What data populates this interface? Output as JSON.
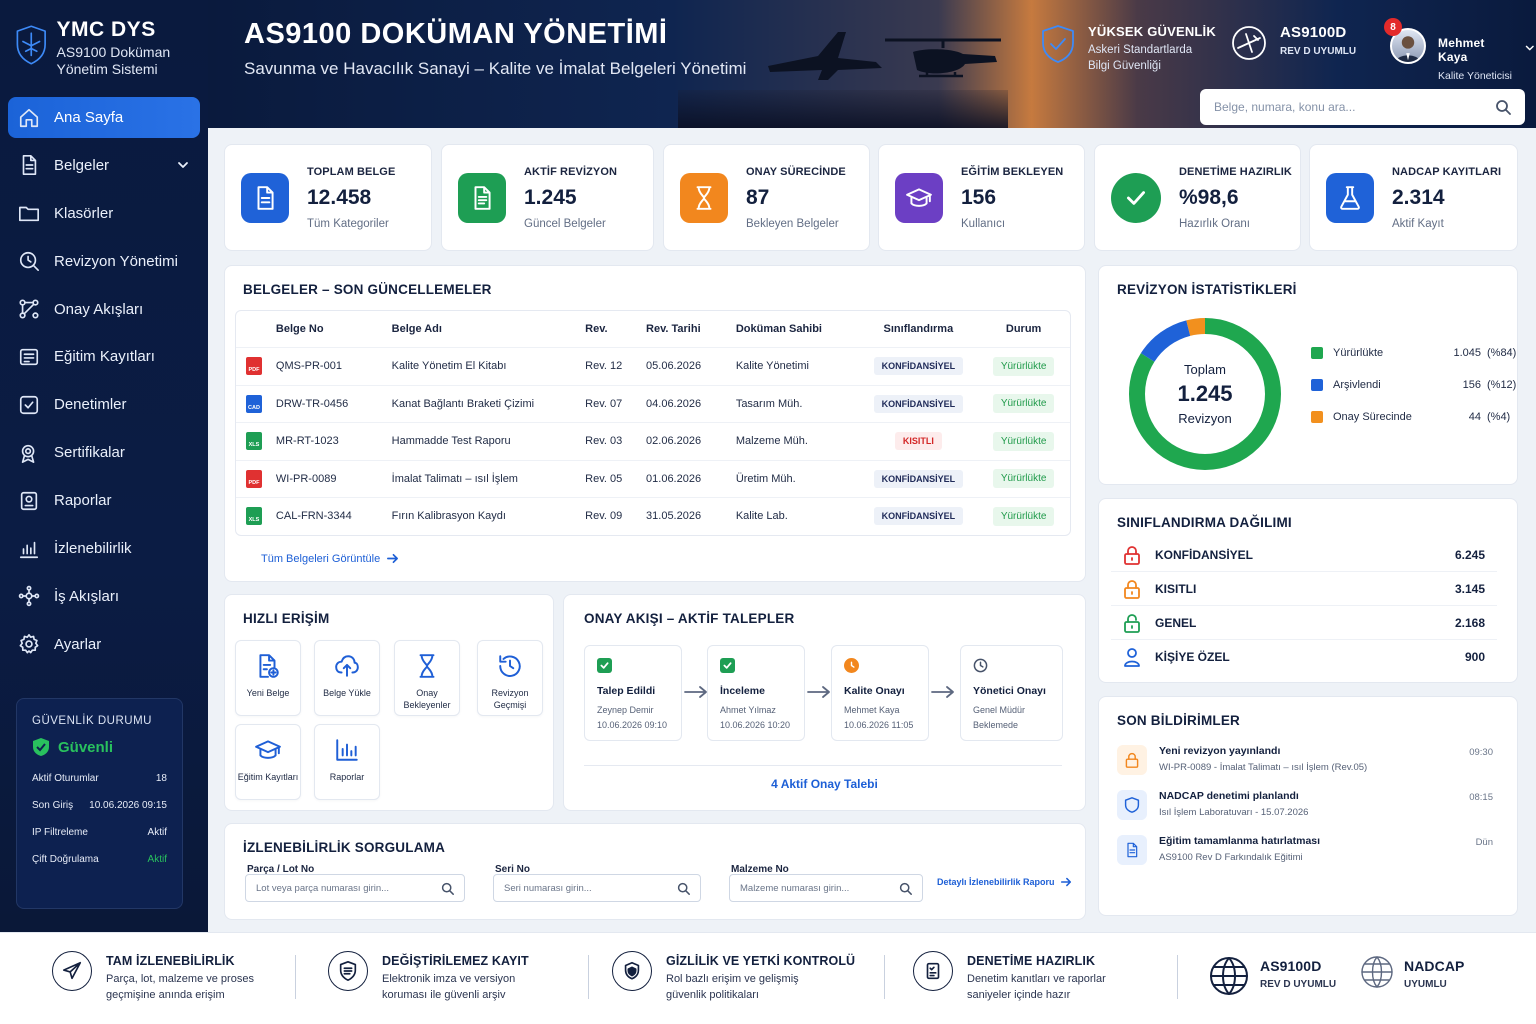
{
  "brand": {
    "name": "YMC DYS",
    "subtitle": "AS9100 Doküman Yönetim Sistemi"
  },
  "sidebar": {
    "items": [
      {
        "label": "Ana Sayfa",
        "icon": "home-icon",
        "active": true
      },
      {
        "label": "Belgeler",
        "icon": "document-icon",
        "has_submenu": true
      },
      {
        "label": "Klasörler",
        "icon": "folder-icon"
      },
      {
        "label": "Revizyon Yönetimi",
        "icon": "revision-icon"
      },
      {
        "label": "Onay Akışları",
        "icon": "workflow-icon"
      },
      {
        "label": "Eğitim Kayıtları",
        "icon": "training-icon"
      },
      {
        "label": "Denetimler",
        "icon": "audit-check-icon"
      },
      {
        "label": "Sertifikalar",
        "icon": "certificate-icon"
      },
      {
        "label": "Raporlar",
        "icon": "report-icon"
      },
      {
        "label": "İzlenebilirlik",
        "icon": "traceability-icon"
      },
      {
        "label": "İş Akışları",
        "icon": "process-icon"
      },
      {
        "label": "Ayarlar",
        "icon": "gear-icon"
      }
    ],
    "security": {
      "title": "GÜVENLİK DURUMU",
      "status": "Güvenli",
      "rows": [
        {
          "label": "Aktif Oturumlar",
          "value": "18"
        },
        {
          "label": "Son Giriş",
          "value": "10.06.2026 09:15"
        },
        {
          "label": "IP Filtreleme",
          "value": "Aktif"
        },
        {
          "label": "Çift Doğrulama",
          "value": "Aktif"
        }
      ]
    }
  },
  "header": {
    "title": "AS9100 DOKÜMAN YÖNETİMİ",
    "subtitle": "Savunma ve Havacılık Sanayi – Kalite ve İmalat Belgeleri Yönetimi",
    "badge1": {
      "title": "YÜKSEK GÜVENLİK",
      "line1": "Askeri Standartlarda",
      "line2": "Bilgi Güvenliği"
    },
    "badge2": {
      "title": "AS9100D",
      "line1": "REV D UYUMLU"
    },
    "user": {
      "name": "Mehmet Kaya",
      "role": "Kalite Yöneticisi",
      "notifications": "8"
    },
    "search": {
      "placeholder": "Belge, numara, konu ara..."
    }
  },
  "kpis": [
    {
      "label": "TOPLAM BELGE",
      "value": "12.458",
      "sub": "Tüm Kategoriler",
      "color": "#1f62d8",
      "icon": "document-icon"
    },
    {
      "label": "AKTİF REVİZYON",
      "value": "1.245",
      "sub": "Güncel Belgeler",
      "color": "#1e9e54",
      "icon": "file-text-icon"
    },
    {
      "label": "ONAY SÜRECİNDE",
      "value": "87",
      "sub": "Bekleyen Belgeler",
      "color": "#f2871e",
      "icon": "hourglass-icon"
    },
    {
      "label": "EĞİTİM BEKLEYEN",
      "value": "156",
      "sub": "Kullanıcı",
      "color": "#6c3fc4",
      "icon": "graduation-cap-icon"
    },
    {
      "label": "DENETİME HAZIRLIK",
      "value": "%98,6",
      "sub": "Hazırlık Oranı",
      "color": "#1e9e54",
      "icon": "check-icon"
    },
    {
      "label": "NADCAP KAYITLARI",
      "value": "2.314",
      "sub": "Aktif Kayıt",
      "color": "#1f62d8",
      "icon": "flask-icon"
    }
  ],
  "documents": {
    "title": "BELGELER – SON GÜNCELLEMELER",
    "columns": [
      "Belge No",
      "Belge Adı",
      "Rev.",
      "Rev. Tarihi",
      "Doküman Sahibi",
      "Sınıflandırma",
      "Durum"
    ],
    "rows": [
      {
        "type": "PDF",
        "no": "QMS-PR-001",
        "name": "Kalite Yönetim El Kitabı",
        "rev": "Rev. 12",
        "date": "05.06.2026",
        "owner": "Kalite Yönetimi",
        "class": "KONFİDANSİYEL",
        "status": "Yürürlükte"
      },
      {
        "type": "CAD",
        "no": "DRW-TR-0456",
        "name": "Kanat Bağlantı Braketi Çizimi",
        "rev": "Rev. 07",
        "date": "04.06.2026",
        "owner": "Tasarım Müh.",
        "class": "KONFİDANSİYEL",
        "status": "Yürürlükte"
      },
      {
        "type": "XLS",
        "no": "MR-RT-1023",
        "name": "Hammadde Test Raporu",
        "rev": "Rev. 03",
        "date": "02.06.2026",
        "owner": "Malzeme Müh.",
        "class": "KISITLI",
        "status": "Yürürlükte"
      },
      {
        "type": "PDF",
        "no": "WI-PR-0089",
        "name": "İmalat Talimatı – ısıl İşlem",
        "rev": "Rev. 05",
        "date": "01.06.2026",
        "owner": "Üretim Müh.",
        "class": "KONFİDANSİYEL",
        "status": "Yürürlükte"
      },
      {
        "type": "XLS",
        "no": "CAL-FRN-3344",
        "name": "Fırın Kalibrasyon Kaydı",
        "rev": "Rev. 09",
        "date": "31.05.2026",
        "owner": "Kalite Lab.",
        "class": "KONFİDANSİYEL",
        "status": "Yürürlükte"
      }
    ],
    "link": "Tüm Belgeleri Görüntüle"
  },
  "quick": {
    "title": "HIZLI ERİŞİM",
    "items": [
      {
        "label": "Yeni Belge",
        "icon": "new-document-icon"
      },
      {
        "label": "Belge Yükle",
        "icon": "upload-cloud-icon"
      },
      {
        "label": "Onay Bekleyenler",
        "icon": "hourglass-icon"
      },
      {
        "label": "Revizyon Geçmişi",
        "icon": "history-icon"
      },
      {
        "label": "Eğitim Kayıtları",
        "icon": "graduation-cap-icon"
      },
      {
        "label": "Raporlar",
        "icon": "bar-chart-icon"
      }
    ]
  },
  "flow": {
    "title": "ONAY AKIŞI – AKTİF TALEPLER",
    "steps": [
      {
        "title": "Talep Edildi",
        "person": "Zeynep Demir",
        "time": "10.06.2026 09:10",
        "state": "done"
      },
      {
        "title": "İnceleme",
        "person": "Ahmet Yılmaz",
        "time": "10.06.2026 10:20",
        "state": "done"
      },
      {
        "title": "Kalite Onayı",
        "person": "Mehmet Kaya",
        "time": "10.06.2026 11:05",
        "state": "progress"
      },
      {
        "title": "Yönetici Onayı",
        "person": "Genel Müdür",
        "time": "Beklemede",
        "state": "pending"
      }
    ],
    "link": "4 Aktif Onay Talebi"
  },
  "trace": {
    "title": "İZLENEBİLİRLİK SORGULAMA",
    "fields": [
      {
        "label": "Parça / Lot No",
        "placeholder": "Lot veya parça numarası girin..."
      },
      {
        "label": "Seri No",
        "placeholder": "Seri numarası girin..."
      },
      {
        "label": "Malzeme No",
        "placeholder": "Malzeme numarası girin..."
      }
    ],
    "link": "Detaylı İzlenebilirlik Raporu"
  },
  "revstats": {
    "title": "REVİZYON İSTATİSTİKLERİ",
    "center_label": "Toplam",
    "center_value": "1.245",
    "center_sub": "Revizyon",
    "segments": [
      {
        "name": "Yürürlükte",
        "value": "1.045",
        "pct": "(%84)",
        "frac": 0.84,
        "color": "#1fa74f"
      },
      {
        "name": "Arşivlendi",
        "value": "156",
        "pct": "(%12)",
        "frac": 0.12,
        "color": "#1f62d8"
      },
      {
        "name": "Onay Sürecinde",
        "value": "44",
        "pct": "(%4)",
        "frac": 0.04,
        "color": "#f2901e"
      }
    ]
  },
  "classdist": {
    "title": "SINIFLANDIRMA DAĞILIMI",
    "rows": [
      {
        "label": "KONFİDANSİYEL",
        "value": "6.245",
        "color": "#e03131",
        "icon": "lock-icon"
      },
      {
        "label": "KISITLI",
        "value": "3.145",
        "color": "#f2871e",
        "icon": "lock-icon"
      },
      {
        "label": "GENEL",
        "value": "2.168",
        "color": "#1e9e54",
        "icon": "unlock-icon"
      },
      {
        "label": "KİŞİYE ÖZEL",
        "value": "900",
        "color": "#1f62d8",
        "icon": "user-icon"
      }
    ]
  },
  "notifications": {
    "title": "SON BİLDİRİMLER",
    "items": [
      {
        "title": "Yeni revizyon yayınlandı",
        "sub": "WI-PR-0089 - İmalat Talimatı – ısıl İşlem (Rev.05)",
        "time": "09:30",
        "icon": "lock-icon",
        "color": "#f2871e",
        "bg": "#fff2e3"
      },
      {
        "title": "NADCAP denetimi planlandı",
        "sub": "Isıl İşlem Laboratuvarı - 15.07.2026",
        "time": "08:15",
        "icon": "shield-icon",
        "color": "#1f62d8",
        "bg": "#e8f0fd"
      },
      {
        "title": "Eğitim tamamlanma hatırlatması",
        "sub": "AS9100 Rev D Farkındalık Eğitimi",
        "time": "Dün",
        "icon": "document-icon",
        "color": "#1f62d8",
        "bg": "#e8f0fd"
      }
    ]
  },
  "footer": {
    "items": [
      {
        "title": "TAM İZLENEBİLİRLİK",
        "line1": "Parça, lot, malzeme ve proses",
        "line2": "geçmişine anında erişim",
        "icon": "airplane-icon"
      },
      {
        "title": "DEĞİŞTİRİLEMEZ KAYIT",
        "line1": "Elektronik imza ve versiyon",
        "line2": "koruması ile güvenli arşiv",
        "icon": "shield-doc-icon"
      },
      {
        "title": "GİZLİLİK VE YETKİ KONTROLÜ",
        "line1": "Rol bazlı erişim ve gelişmiş",
        "line2": "güvenlik politikaları",
        "icon": "shield-lock-icon"
      },
      {
        "title": "DENETİME HAZIRLIK",
        "line1": "Denetim kanıtları ve raporlar",
        "line2": "saniyeler içinde hazır",
        "icon": "checklist-icon"
      }
    ],
    "badge1": {
      "title": "AS9100D",
      "sub": "REV D UYUMLU"
    },
    "badge2": {
      "title": "NADCAP",
      "sub": "UYUMLU"
    }
  }
}
